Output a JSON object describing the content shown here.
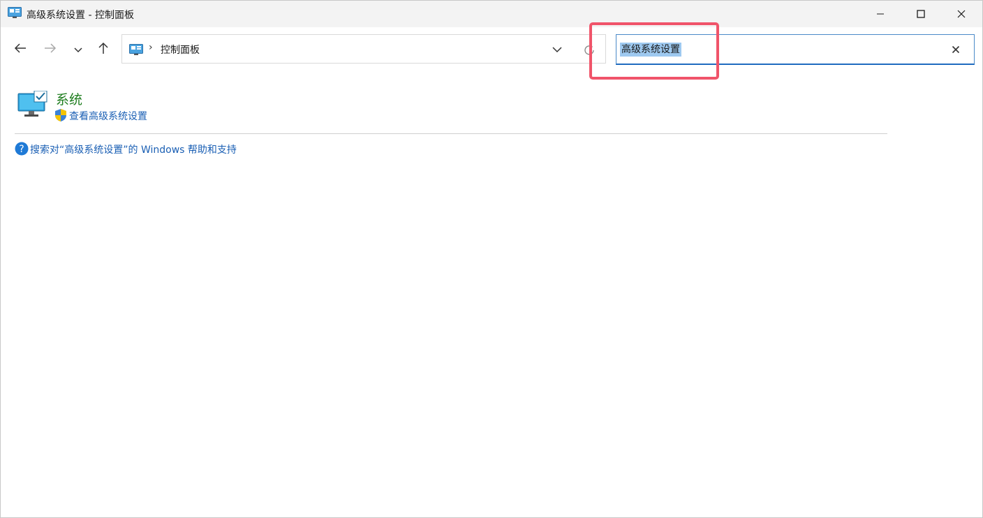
{
  "window": {
    "title": "高级系统设置 - 控制面板"
  },
  "titlebar": {
    "icons": [
      "control-panel-icon",
      "minimize-icon",
      "maximize-icon",
      "close-icon"
    ]
  },
  "nav": {
    "icons": [
      "back-arrow-icon",
      "forward-arrow-icon",
      "recent-chevron-icon",
      "up-arrow-icon"
    ]
  },
  "address": {
    "separator": "›",
    "path": "控制面板",
    "icons": [
      "control-panel-icon",
      "chevron-down-icon",
      "refresh-icon"
    ]
  },
  "search": {
    "value": "高级系统设置",
    "icon": "clear-x-icon",
    "highlight_color": "#f0546a"
  },
  "results": {
    "category_title": "系统",
    "category_link": "查看高级系统设置",
    "help_link": "搜索对“高级系统设置”的 Windows 帮助和支持",
    "icons": [
      "computer-monitor-icon",
      "uac-shield-icon",
      "help-question-icon"
    ]
  },
  "colors": {
    "category_green": "#1e7d1e",
    "link_blue": "#1a5fb4",
    "selection_blue": "#9ec9f0"
  }
}
